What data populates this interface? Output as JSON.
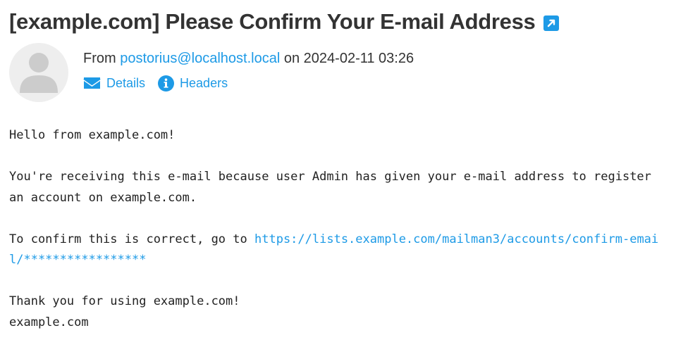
{
  "email": {
    "subject": "[example.com] Please Confirm Your E-mail Address",
    "from_prefix": "From ",
    "sender": "postorius@localhost.local",
    "date_prefix": " on ",
    "date": "2024-02-11 03:26"
  },
  "actions": {
    "details": "Details",
    "headers": "Headers"
  },
  "body": {
    "greeting": "Hello from example.com!",
    "paragraph1": "You're receiving this e-mail because user Admin has given your e-mail address to register an account on example.com.",
    "confirm_prefix": "To confirm this is correct, go to ",
    "confirm_url": "https://lists.example.com/mailman3/accounts/confirm-email/*****************",
    "thanks": "Thank you for using example.com!",
    "signature": "example.com"
  },
  "icons": {
    "external": "external-link-icon",
    "avatar": "user-avatar-icon",
    "details": "envelope-icon",
    "headers": "info-icon"
  },
  "colors": {
    "accent": "#1d9ae6",
    "title": "#333333",
    "avatar_bg": "#eeeeee",
    "avatar_fg": "#cccccc"
  }
}
